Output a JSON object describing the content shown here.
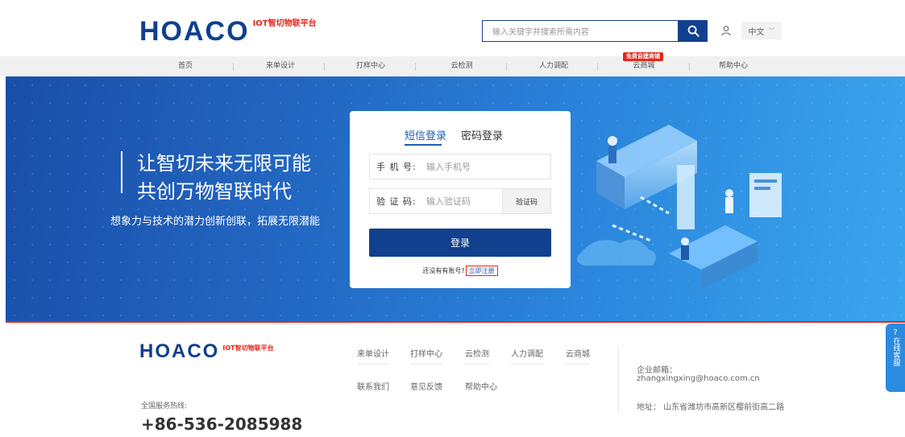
{
  "header": {
    "logo_text": "HOACO",
    "logo_sub": "IOT智切物联平台",
    "search_placeholder": "输入关键字并搜索所需内容",
    "lang": "中文"
  },
  "nav": {
    "items": [
      "首页",
      "来单设计",
      "打样中心",
      "云检测",
      "人力调配",
      "云商城",
      "帮助中心"
    ],
    "badge": "免费自建商铺"
  },
  "banner": {
    "slogan_line1": "让智切未来无限可能",
    "slogan_line2": "共创万物智联时代",
    "tagline": "想象力与技术的潜力创新创联，拓展无限潜能"
  },
  "login": {
    "tab_sms": "短信登录",
    "tab_password": "密码登录",
    "phone_label": "手 机 号:",
    "phone_placeholder": "输入手机号",
    "code_label": "验 证 码:",
    "code_placeholder": "输入验证码",
    "code_button": "验证码",
    "submit": "登录",
    "no_account": "还没有有账号?",
    "register": "立即注册"
  },
  "footer": {
    "logo_text": "HOACO",
    "logo_sub": "IOT智切物联平台",
    "hotline_label": "全国服务热线:",
    "hotline": "+86-536-2085988",
    "links_row1": [
      "来单设计",
      "打样中心",
      "云检测",
      "人力调配",
      "云商城"
    ],
    "links_row2": [
      "联系我们",
      "意见反馈",
      "帮助中心"
    ],
    "email_label": "企业邮箱：",
    "email": "zhangxingxing@hoaco.com.cn",
    "address": "地址： 山东省潍坊市高新区樱前街高二路"
  },
  "customer_service": {
    "label": "在线客服"
  },
  "colors": {
    "brand": "#10408e",
    "accent_red": "#e4261b",
    "link_blue": "#1f5cb4"
  }
}
